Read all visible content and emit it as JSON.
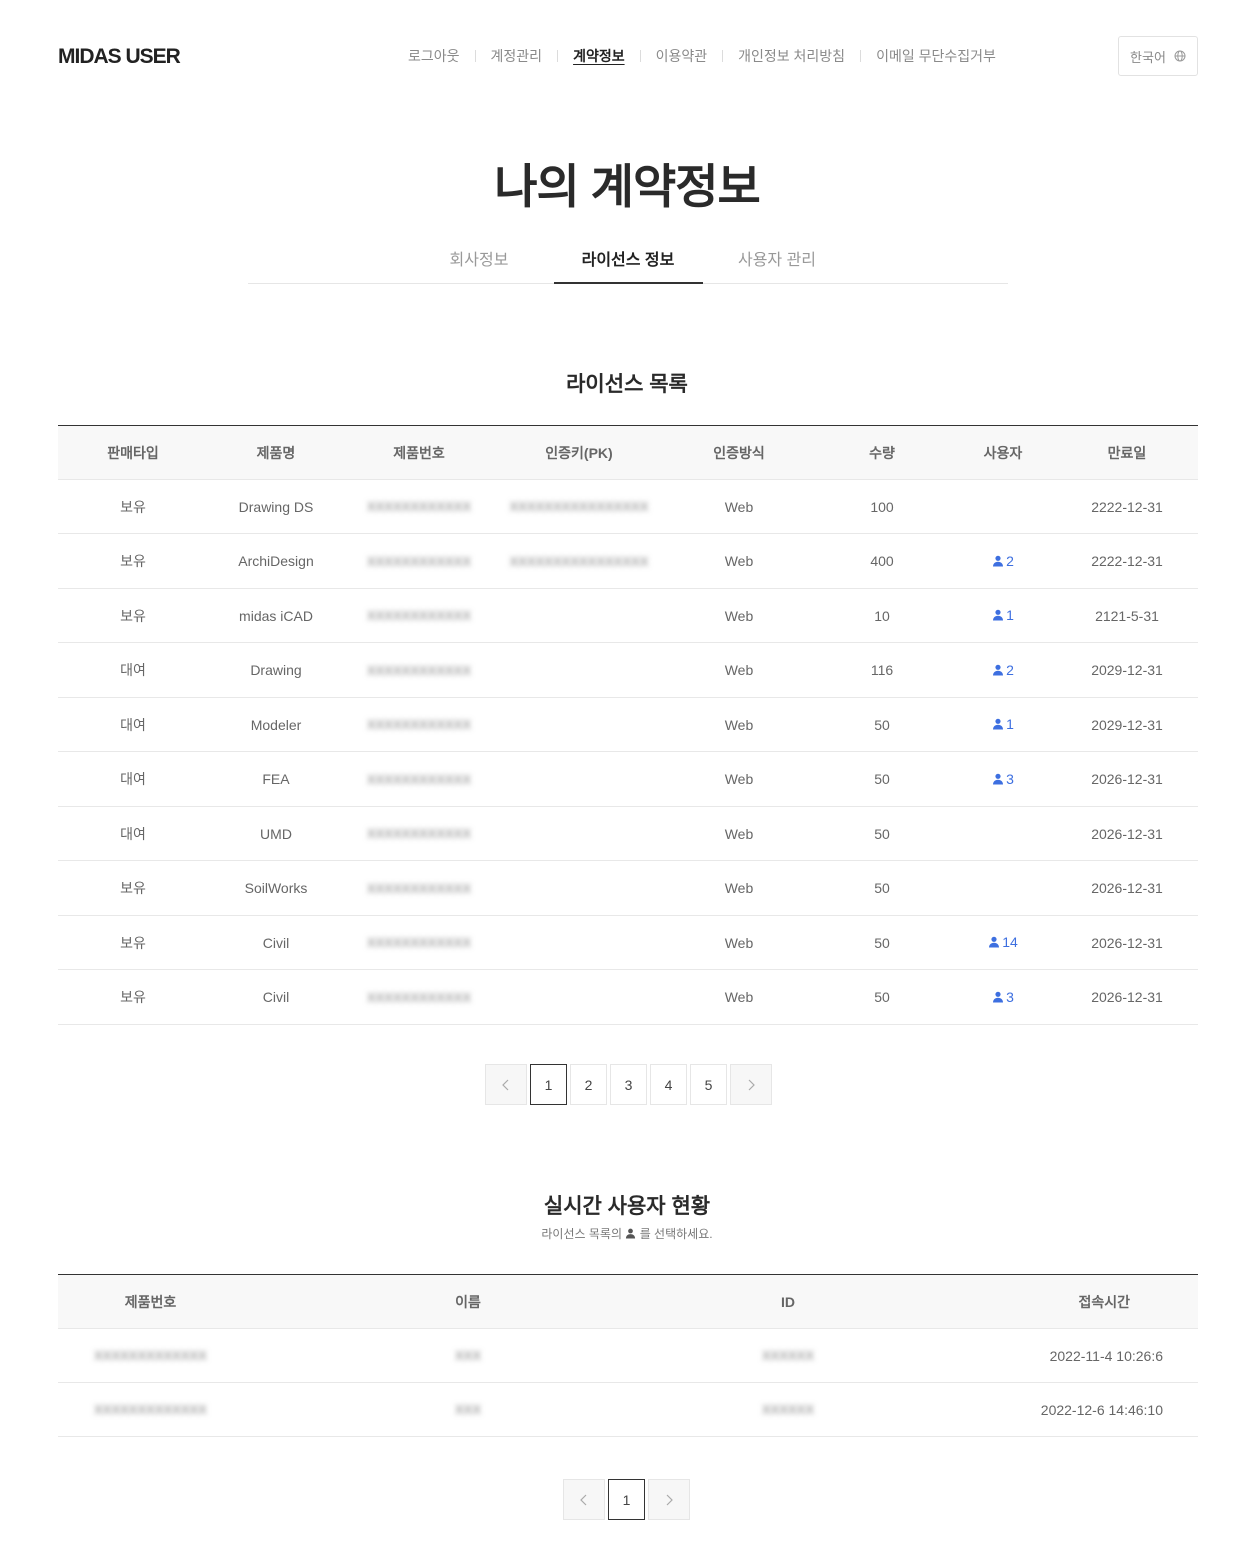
{
  "header": {
    "logo": "MIDAS USER",
    "nav": [
      {
        "label": "로그아웃",
        "active": false
      },
      {
        "label": "계정관리",
        "active": false
      },
      {
        "label": "계약정보",
        "active": true
      },
      {
        "label": "이용약관",
        "active": false
      },
      {
        "label": "개인정보 처리방침",
        "active": false
      },
      {
        "label": "이메일 무단수집거부",
        "active": false
      }
    ],
    "language": "한국어"
  },
  "page_title": "나의 계약정보",
  "tabs": [
    {
      "label": "회사정보",
      "active": false
    },
    {
      "label": "라이선스 정보",
      "active": true
    },
    {
      "label": "사용자 관리",
      "active": false
    }
  ],
  "license_section": {
    "title": "라이선스 목록",
    "columns": [
      "판매타입",
      "제품명",
      "제품번호",
      "인증키(PK)",
      "인증방식",
      "수량",
      "사용자",
      "만료일"
    ],
    "rows": [
      {
        "type": "보유",
        "product": "Drawing DS",
        "serial": "XXXXXXXXXXXX",
        "pk": "XXXXXXXXXXXXXXXX",
        "auth": "Web",
        "qty": "100",
        "users": "",
        "expiry": "2222-12-31"
      },
      {
        "type": "보유",
        "product": "ArchiDesign",
        "serial": "XXXXXXXXXXXX",
        "pk": "XXXXXXXXXXXXXXXX",
        "auth": "Web",
        "qty": "400",
        "users": "2",
        "expiry": "2222-12-31"
      },
      {
        "type": "보유",
        "product": "midas iCAD",
        "serial": "XXXXXXXXXXXX",
        "pk": "",
        "auth": "Web",
        "qty": "10",
        "users": "1",
        "expiry": "2121-5-31"
      },
      {
        "type": "대여",
        "product": "Drawing",
        "serial": "XXXXXXXXXXXX",
        "pk": "",
        "auth": "Web",
        "qty": "116",
        "users": "2",
        "expiry": "2029-12-31"
      },
      {
        "type": "대여",
        "product": "Modeler",
        "serial": "XXXXXXXXXXXX",
        "pk": "",
        "auth": "Web",
        "qty": "50",
        "users": "1",
        "expiry": "2029-12-31"
      },
      {
        "type": "대여",
        "product": "FEA",
        "serial": "XXXXXXXXXXXX",
        "pk": "",
        "auth": "Web",
        "qty": "50",
        "users": "3",
        "expiry": "2026-12-31"
      },
      {
        "type": "대여",
        "product": "UMD",
        "serial": "XXXXXXXXXXXX",
        "pk": "",
        "auth": "Web",
        "qty": "50",
        "users": "",
        "expiry": "2026-12-31"
      },
      {
        "type": "보유",
        "product": "SoilWorks",
        "serial": "XXXXXXXXXXXX",
        "pk": "",
        "auth": "Web",
        "qty": "50",
        "users": "",
        "expiry": "2026-12-31"
      },
      {
        "type": "보유",
        "product": "Civil",
        "serial": "XXXXXXXXXXXX",
        "pk": "",
        "auth": "Web",
        "qty": "50",
        "users": "14",
        "expiry": "2026-12-31"
      },
      {
        "type": "보유",
        "product": "Civil",
        "serial": "XXXXXXXXXXXX",
        "pk": "",
        "auth": "Web",
        "qty": "50",
        "users": "3",
        "expiry": "2026-12-31"
      }
    ],
    "pagination": {
      "pages": [
        "1",
        "2",
        "3",
        "4",
        "5"
      ],
      "current": "1"
    }
  },
  "realtime_section": {
    "title": "실시간 사용자 현황",
    "subtitle_before": "라이선스 목록의",
    "subtitle_after": "를 선택하세요.",
    "columns": [
      "제품번호",
      "이름",
      "ID",
      "접속시간"
    ],
    "rows": [
      {
        "serial": "XXXXXXXXXXXXX",
        "name": "XXX",
        "id": "XXXXXX",
        "time": "2022-11-4 10:26:6"
      },
      {
        "serial": "XXXXXXXXXXXXX",
        "name": "XXX",
        "id": "XXXXXX",
        "time": "2022-12-6 14:46:10"
      }
    ],
    "pagination": {
      "pages": [
        "1"
      ],
      "current": "1"
    }
  },
  "colors": {
    "accent_blue": "#3d6fe0",
    "text_dark": "#222222",
    "border": "#e8e8e8"
  }
}
